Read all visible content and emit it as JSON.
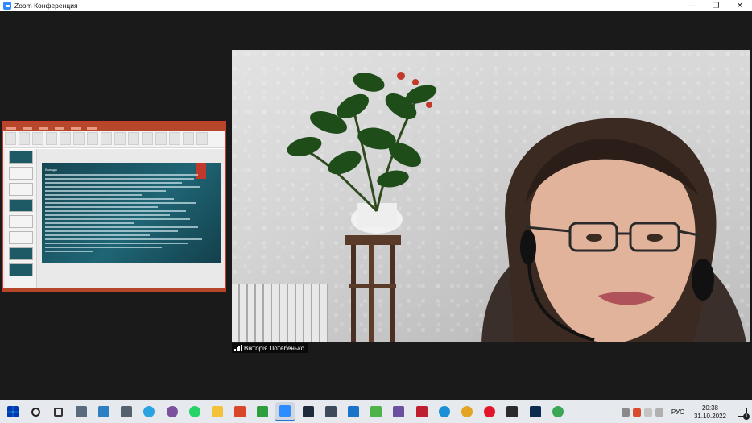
{
  "window": {
    "title": "Zoom Конференция",
    "controls": {
      "minimize": "—",
      "maximize": "❐",
      "close": "✕"
    }
  },
  "video": {
    "participant_name": "Вікторія Потебенько"
  },
  "shared_screen": {
    "app": "PowerPoint",
    "slide_heading": "Выводы"
  },
  "taskbar": {
    "icons": [
      {
        "name": "windows-start-icon",
        "color": "#0078d4"
      },
      {
        "name": "search-icon",
        "color": "#222222"
      },
      {
        "name": "task-view-icon",
        "color": "#333333"
      },
      {
        "name": "explorer-window-icon",
        "color": "#5a6b7d"
      },
      {
        "name": "monitor-app-icon",
        "color": "#2d7fc1"
      },
      {
        "name": "calculator-icon",
        "color": "#55616e"
      },
      {
        "name": "telegram-icon",
        "color": "#2aa3e0"
      },
      {
        "name": "viber-icon",
        "color": "#7b519d"
      },
      {
        "name": "whatsapp-icon",
        "color": "#25d366"
      },
      {
        "name": "folder-icon",
        "color": "#f3c13a"
      },
      {
        "name": "red-app-icon",
        "color": "#d9472b"
      },
      {
        "name": "green-c-app-icon",
        "color": "#2e9e3f"
      },
      {
        "name": "zoom-icon",
        "color": "#2d8cff"
      },
      {
        "name": "screen-app-icon",
        "color": "#1f2a3a"
      },
      {
        "name": "davinci-icon",
        "color": "#3d4a5a"
      },
      {
        "name": "chat-app-icon",
        "color": "#1b73c9"
      },
      {
        "name": "green-app-icon",
        "color": "#4fb34a"
      },
      {
        "name": "archive-icon",
        "color": "#6b4fa0"
      },
      {
        "name": "filezilla-icon",
        "color": "#bf1e2e"
      },
      {
        "name": "edge-icon",
        "color": "#1d8fd6"
      },
      {
        "name": "chrome-icon",
        "color": "#e4a423"
      },
      {
        "name": "opera-icon",
        "color": "#e2162b"
      },
      {
        "name": "v-app-icon",
        "color": "#2b2b2b"
      },
      {
        "name": "photoshop-icon",
        "color": "#0c2b4f"
      },
      {
        "name": "chrome-profile-icon",
        "color": "#3aa757"
      }
    ],
    "active_icon_index": 12,
    "language": "РУС",
    "time": "20:38",
    "date": "31.10.2022",
    "notification_count": "1"
  }
}
